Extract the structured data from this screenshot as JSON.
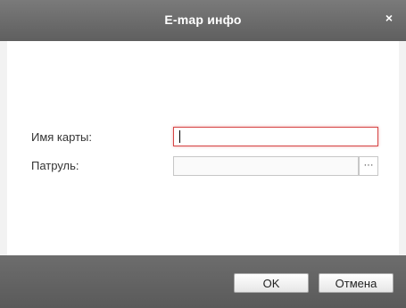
{
  "dialog": {
    "title": "E-map инфо",
    "close_label": "×"
  },
  "form": {
    "map_name_label": "Имя карты:",
    "map_name_value": "",
    "patrol_label": "Патруль:",
    "patrol_value": "",
    "browse_label": "···"
  },
  "footer": {
    "ok_label": "OK",
    "cancel_label": "Отмена"
  },
  "colors": {
    "titlebar": "#6b6b6b",
    "error_border": "#d64545",
    "footer": "#636363"
  },
  "icons": {
    "close": "close-icon",
    "browse": "ellipsis-icon"
  }
}
